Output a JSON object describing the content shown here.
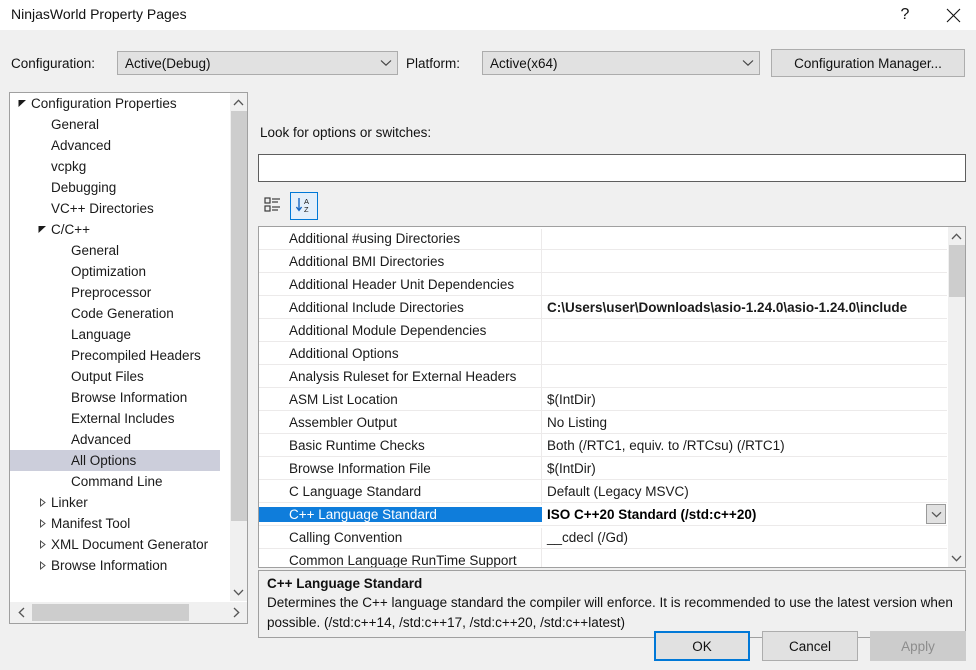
{
  "window": {
    "title": "NinjasWorld Property Pages",
    "help_icon": "question-mark-icon",
    "close_icon": "close-icon"
  },
  "config_bar": {
    "configuration_label": "Configuration:",
    "configuration_value": "Active(Debug)",
    "platform_label": "Platform:",
    "platform_value": "Active(x64)",
    "configuration_manager_button": "Configuration Manager..."
  },
  "tree": {
    "items": [
      {
        "label": "Configuration Properties",
        "indent": 0,
        "arrow": "expanded",
        "selected": false
      },
      {
        "label": "General",
        "indent": 1,
        "arrow": "none",
        "selected": false
      },
      {
        "label": "Advanced",
        "indent": 1,
        "arrow": "none",
        "selected": false
      },
      {
        "label": "vcpkg",
        "indent": 1,
        "arrow": "none",
        "selected": false
      },
      {
        "label": "Debugging",
        "indent": 1,
        "arrow": "none",
        "selected": false
      },
      {
        "label": "VC++ Directories",
        "indent": 1,
        "arrow": "none",
        "selected": false
      },
      {
        "label": "C/C++",
        "indent": 1,
        "arrow": "expanded",
        "selected": false
      },
      {
        "label": "General",
        "indent": 2,
        "arrow": "none",
        "selected": false
      },
      {
        "label": "Optimization",
        "indent": 2,
        "arrow": "none",
        "selected": false
      },
      {
        "label": "Preprocessor",
        "indent": 2,
        "arrow": "none",
        "selected": false
      },
      {
        "label": "Code Generation",
        "indent": 2,
        "arrow": "none",
        "selected": false
      },
      {
        "label": "Language",
        "indent": 2,
        "arrow": "none",
        "selected": false
      },
      {
        "label": "Precompiled Headers",
        "indent": 2,
        "arrow": "none",
        "selected": false
      },
      {
        "label": "Output Files",
        "indent": 2,
        "arrow": "none",
        "selected": false
      },
      {
        "label": "Browse Information",
        "indent": 2,
        "arrow": "none",
        "selected": false
      },
      {
        "label": "External Includes",
        "indent": 2,
        "arrow": "none",
        "selected": false
      },
      {
        "label": "Advanced",
        "indent": 2,
        "arrow": "none",
        "selected": false
      },
      {
        "label": "All Options",
        "indent": 2,
        "arrow": "none",
        "selected": true
      },
      {
        "label": "Command Line",
        "indent": 2,
        "arrow": "none",
        "selected": false
      },
      {
        "label": "Linker",
        "indent": 1,
        "arrow": "collapsed",
        "selected": false
      },
      {
        "label": "Manifest Tool",
        "indent": 1,
        "arrow": "collapsed",
        "selected": false
      },
      {
        "label": "XML Document Generator",
        "indent": 1,
        "arrow": "collapsed",
        "selected": false
      },
      {
        "label": "Browse Information",
        "indent": 1,
        "arrow": "collapsed",
        "selected": false
      }
    ]
  },
  "search": {
    "label": "Look for options or switches:",
    "value": "",
    "placeholder": ""
  },
  "toolbar": {
    "categorized_icon": "categorized-view-icon",
    "alphabetical_icon": "sort-alphabetical-icon",
    "active": "alphabetical"
  },
  "properties": {
    "rows": [
      {
        "name": "Additional #using Directories",
        "value": "",
        "selected": false,
        "bold": false,
        "dropdown": false
      },
      {
        "name": "Additional BMI Directories",
        "value": "",
        "selected": false,
        "bold": false,
        "dropdown": false
      },
      {
        "name": "Additional Header Unit Dependencies",
        "value": "",
        "selected": false,
        "bold": false,
        "dropdown": false
      },
      {
        "name": "Additional Include Directories",
        "value": "C:\\Users\\user\\Downloads\\asio-1.24.0\\asio-1.24.0\\include",
        "selected": false,
        "bold": true,
        "dropdown": false
      },
      {
        "name": "Additional Module Dependencies",
        "value": "",
        "selected": false,
        "bold": false,
        "dropdown": false
      },
      {
        "name": "Additional Options",
        "value": "",
        "selected": false,
        "bold": false,
        "dropdown": false
      },
      {
        "name": "Analysis Ruleset for External Headers",
        "value": "",
        "selected": false,
        "bold": false,
        "dropdown": false
      },
      {
        "name": "ASM List Location",
        "value": "$(IntDir)",
        "selected": false,
        "bold": false,
        "dropdown": false
      },
      {
        "name": "Assembler Output",
        "value": "No Listing",
        "selected": false,
        "bold": false,
        "dropdown": false
      },
      {
        "name": "Basic Runtime Checks",
        "value": "Both (/RTC1, equiv. to /RTCsu) (/RTC1)",
        "selected": false,
        "bold": false,
        "dropdown": false
      },
      {
        "name": "Browse Information File",
        "value": "$(IntDir)",
        "selected": false,
        "bold": false,
        "dropdown": false
      },
      {
        "name": "C Language Standard",
        "value": "Default (Legacy MSVC)",
        "selected": false,
        "bold": false,
        "dropdown": false
      },
      {
        "name": "C++ Language Standard",
        "value": "ISO C++20 Standard (/std:c++20)",
        "selected": true,
        "bold": true,
        "dropdown": true
      },
      {
        "name": "Calling Convention",
        "value": "__cdecl (/Gd)",
        "selected": false,
        "bold": false,
        "dropdown": false
      },
      {
        "name": "Common Language RunTime Support",
        "value": "",
        "selected": false,
        "bold": false,
        "dropdown": false
      }
    ]
  },
  "description": {
    "title": "C++ Language Standard",
    "text": "Determines the C++ language standard the compiler will enforce. It is recommended to use the latest version when possible. (/std:c++14, /std:c++17, /std:c++20, /std:c++latest)"
  },
  "footer": {
    "ok": "OK",
    "cancel": "Cancel",
    "apply": "Apply"
  },
  "colors": {
    "selection_blue": "#0f7ddb",
    "tree_selection": "#cccedb",
    "accent_focus": "#0078d7",
    "dialog_bg": "#f0f0f0"
  }
}
